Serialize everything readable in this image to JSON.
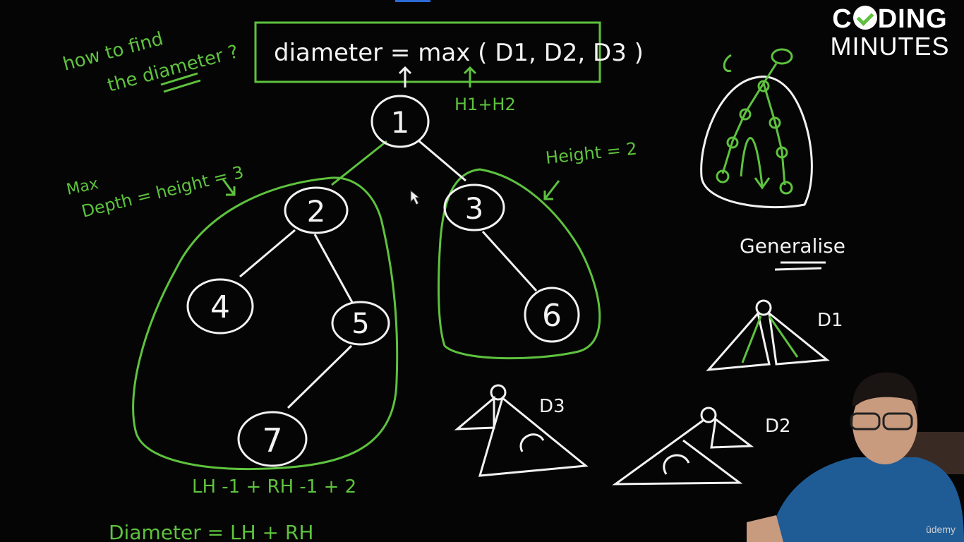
{
  "brand": {
    "line1_a": "C",
    "line1_b": "DING",
    "line2": "MINUTES"
  },
  "question": {
    "line1": "how to find",
    "line2": "the diameter ?"
  },
  "formula": {
    "text": "diameter = max ( D1, D2, D3 )",
    "hint": "H1+H2"
  },
  "annotations": {
    "max_depth": "Max",
    "depth_height": "Depth = height = 3",
    "height_right": "Height = 2",
    "generalise": "Generalise",
    "lh_rh": "LH -1  +  RH -1  + 2",
    "diameter_bottom": "Diameter  =   LH + RH"
  },
  "tree_nodes": [
    "1",
    "2",
    "3",
    "4",
    "5",
    "6",
    "7"
  ],
  "cases": {
    "d1": "D1",
    "d2": "D2",
    "d3": "D3"
  },
  "watermark": "ûdemy",
  "colors": {
    "green": "#5ec23e",
    "white": "#f2f2f2",
    "background": "#050505"
  }
}
